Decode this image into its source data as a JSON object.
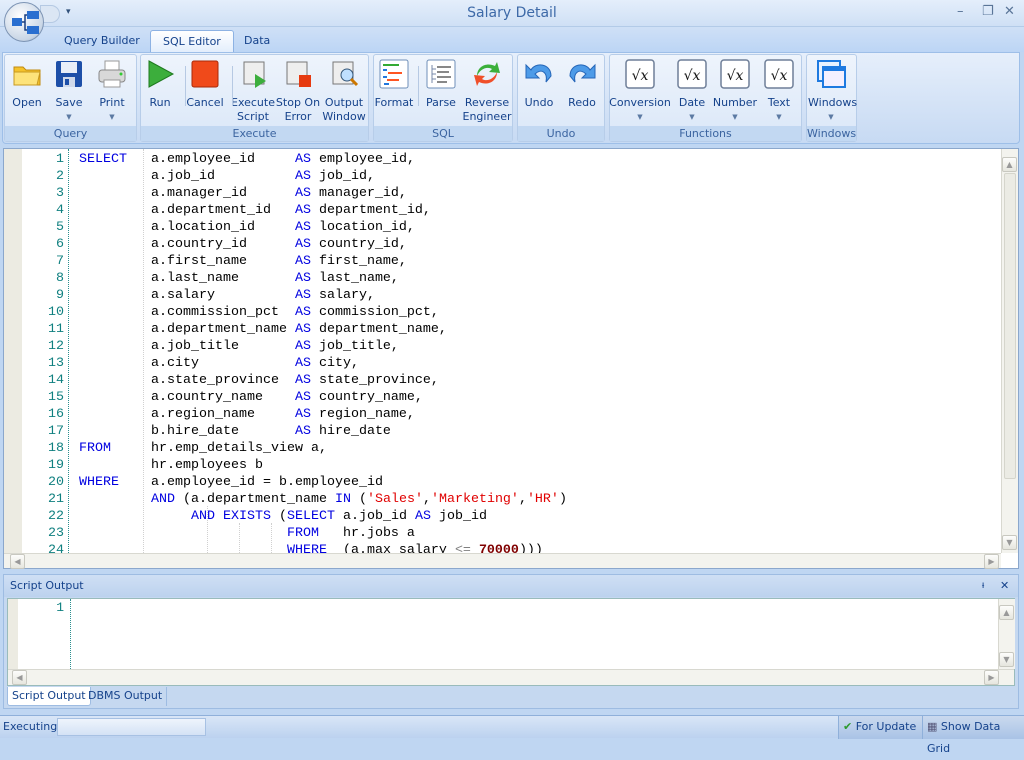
{
  "window": {
    "title": "Salary Detail",
    "minimize": "–",
    "restore": "❐",
    "close": "✕"
  },
  "tabs": [
    {
      "label": "Query Builder"
    },
    {
      "label": "SQL Editor",
      "active": true
    },
    {
      "label": "Data"
    }
  ],
  "ribbon": {
    "groups": [
      {
        "label": "Query",
        "buttons": [
          {
            "label": "Open",
            "icon": "folder-icon"
          },
          {
            "label": "Save",
            "icon": "save-icon",
            "dropdown": true
          },
          {
            "label": "Print",
            "icon": "printer-icon",
            "dropdown": true
          }
        ]
      },
      {
        "label": "Execute",
        "buttons": [
          {
            "label": "Run",
            "icon": "play-icon"
          },
          {
            "label": "Cancel",
            "icon": "stop-icon"
          },
          {
            "label": "Execute\nScript",
            "icon": "script-run-icon"
          },
          {
            "label": "Stop On\nError",
            "icon": "script-stop-icon"
          },
          {
            "label": "Output\nWindow",
            "icon": "script-search-icon"
          }
        ]
      },
      {
        "label": "SQL",
        "buttons": [
          {
            "label": "Format",
            "icon": "format-icon"
          },
          {
            "label": "Parse",
            "icon": "parse-tree-icon"
          },
          {
            "label": "Reverse\nEngineer",
            "icon": "reverse-arrows-icon"
          }
        ]
      },
      {
        "label": "Undo",
        "buttons": [
          {
            "label": "Undo",
            "icon": "undo-icon"
          },
          {
            "label": "Redo",
            "icon": "redo-icon"
          }
        ]
      },
      {
        "label": "Functions",
        "buttons": [
          {
            "label": "Conversion",
            "icon": "sqrt-function-icon",
            "dropdown": true
          },
          {
            "label": "Date",
            "icon": "sqrt-function-icon",
            "dropdown": true
          },
          {
            "label": "Number",
            "icon": "sqrt-function-icon",
            "dropdown": true
          },
          {
            "label": "Text",
            "icon": "sqrt-function-icon",
            "dropdown": true
          }
        ]
      },
      {
        "label": "Windows",
        "buttons": [
          {
            "label": "Windows",
            "icon": "windows-icon",
            "dropdown": true
          }
        ]
      }
    ]
  },
  "editor": {
    "lines": [
      [
        [
          "kw",
          "SELECT"
        ],
        [
          "",
          "   a.employee_id     "
        ],
        [
          "kw",
          "AS"
        ],
        [
          "",
          " employee_id,"
        ]
      ],
      [
        [
          "",
          "         a.job_id          "
        ],
        [
          "kw",
          "AS"
        ],
        [
          "",
          " job_id,"
        ]
      ],
      [
        [
          "",
          "         a.manager_id      "
        ],
        [
          "kw",
          "AS"
        ],
        [
          "",
          " manager_id,"
        ]
      ],
      [
        [
          "",
          "         a.department_id   "
        ],
        [
          "kw",
          "AS"
        ],
        [
          "",
          " department_id,"
        ]
      ],
      [
        [
          "",
          "         a.location_id     "
        ],
        [
          "kw",
          "AS"
        ],
        [
          "",
          " location_id,"
        ]
      ],
      [
        [
          "",
          "         a.country_id      "
        ],
        [
          "kw",
          "AS"
        ],
        [
          "",
          " country_id,"
        ]
      ],
      [
        [
          "",
          "         a.first_name      "
        ],
        [
          "kw",
          "AS"
        ],
        [
          "",
          " first_name,"
        ]
      ],
      [
        [
          "",
          "         a.last_name       "
        ],
        [
          "kw",
          "AS"
        ],
        [
          "",
          " last_name,"
        ]
      ],
      [
        [
          "",
          "         a.salary          "
        ],
        [
          "kw",
          "AS"
        ],
        [
          "",
          " salary,"
        ]
      ],
      [
        [
          "",
          "         a.commission_pct  "
        ],
        [
          "kw",
          "AS"
        ],
        [
          "",
          " commission_pct,"
        ]
      ],
      [
        [
          "",
          "         a.department_name "
        ],
        [
          "kw",
          "AS"
        ],
        [
          "",
          " department_name,"
        ]
      ],
      [
        [
          "",
          "         a.job_title       "
        ],
        [
          "kw",
          "AS"
        ],
        [
          "",
          " job_title,"
        ]
      ],
      [
        [
          "",
          "         a.city            "
        ],
        [
          "kw",
          "AS"
        ],
        [
          "",
          " city,"
        ]
      ],
      [
        [
          "",
          "         a.state_province  "
        ],
        [
          "kw",
          "AS"
        ],
        [
          "",
          " state_province,"
        ]
      ],
      [
        [
          "",
          "         a.country_name    "
        ],
        [
          "kw",
          "AS"
        ],
        [
          "",
          " country_name,"
        ]
      ],
      [
        [
          "",
          "         a.region_name     "
        ],
        [
          "kw",
          "AS"
        ],
        [
          "",
          " region_name,"
        ]
      ],
      [
        [
          "",
          "         b.hire_date       "
        ],
        [
          "kw",
          "AS"
        ],
        [
          "",
          " hire_date"
        ]
      ],
      [
        [
          "kw",
          "FROM"
        ],
        [
          "",
          "     hr.emp_details_view a,"
        ]
      ],
      [
        [
          "",
          "         hr.employees b"
        ]
      ],
      [
        [
          "kw",
          "WHERE"
        ],
        [
          "",
          "    a.employee_id = b.employee_id"
        ]
      ],
      [
        [
          "",
          "         "
        ],
        [
          "kw",
          "AND"
        ],
        [
          "",
          " (a.department_name "
        ],
        [
          "kw",
          "IN"
        ],
        [
          "",
          " ("
        ],
        [
          "str",
          "'Sales'"
        ],
        [
          "",
          ","
        ],
        [
          "str",
          "'Marketing'"
        ],
        [
          "",
          ","
        ],
        [
          "str",
          "'HR'"
        ],
        [
          "",
          ")"
        ]
      ],
      [
        [
          "",
          "              "
        ],
        [
          "kw",
          "AND EXISTS"
        ],
        [
          "",
          " ("
        ],
        [
          "kw",
          "SELECT"
        ],
        [
          "",
          " a.job_id "
        ],
        [
          "kw",
          "AS"
        ],
        [
          "",
          " job_id"
        ]
      ],
      [
        [
          "",
          "                          "
        ],
        [
          "kw",
          "FROM"
        ],
        [
          "",
          "   hr.jobs a"
        ]
      ],
      [
        [
          "",
          "                          "
        ],
        [
          "kw",
          "WHERE"
        ],
        [
          "",
          "  (a.max_salary "
        ],
        [
          "op",
          "<="
        ],
        [
          "",
          " "
        ],
        [
          "num",
          "70000"
        ],
        [
          "",
          ")))"
        ]
      ]
    ]
  },
  "output": {
    "title": "Script Output",
    "pin": "📌",
    "close": "✕",
    "line_number": "1",
    "tabs": [
      {
        "label": "Script Output",
        "active": true
      },
      {
        "label": "DBMS Output"
      }
    ]
  },
  "status": {
    "executing_label": "Executing:",
    "executing_progress": 0,
    "for_update": "For Update",
    "show_data_grid": "Show Data Grid"
  }
}
